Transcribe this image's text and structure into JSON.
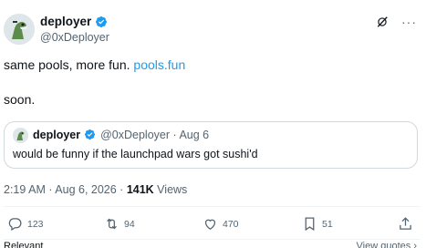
{
  "author": {
    "display_name": "deployer",
    "handle": "@0xDeployer"
  },
  "post": {
    "text_prefix": "same pools, more fun. ",
    "link": "pools.fun",
    "line2": "soon."
  },
  "quote": {
    "display_name": "deployer",
    "meta": "@0xDeployer · Aug 6",
    "text": "would be funny if the launchpad wars got sushi'd"
  },
  "meta": {
    "time": "2:19 AM · Aug 6, 2026 · ",
    "views_count": "141K",
    "views_label": " Views"
  },
  "actions": {
    "replies": "123",
    "reposts": "94",
    "likes": "470",
    "bookmarks": "51"
  },
  "footer": {
    "left": "Relevant",
    "right": "View quotes ›"
  },
  "colors": {
    "accent": "#1d9bf0",
    "text": "#0f1419",
    "muted": "#536471"
  },
  "icons": [
    "verified-badge-icon",
    "grok-icon",
    "more-icon",
    "reply-icon",
    "repost-icon",
    "like-icon",
    "bookmark-icon",
    "share-icon"
  ]
}
